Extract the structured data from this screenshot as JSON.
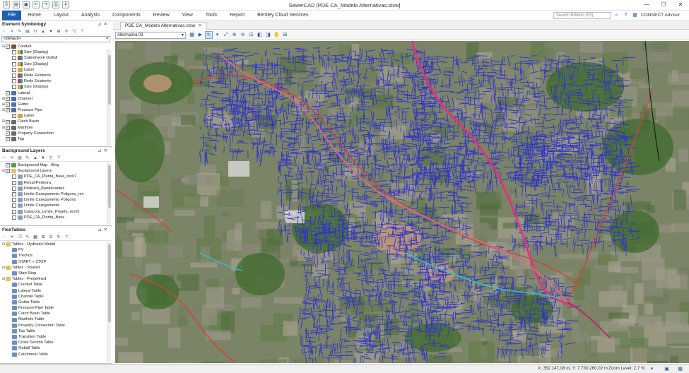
{
  "window": {
    "title": "SewerCAD [PDE CA_Modelo Alternativas.stsw]",
    "controls": [
      "—",
      "☐",
      "✕"
    ]
  },
  "menu": {
    "tabs": [
      "File",
      "Home",
      "Layout",
      "Analysis",
      "Components",
      "Review",
      "View",
      "Tools",
      "Report",
      "Bentley Cloud Services"
    ],
    "search_placeholder": "Search Ribbon (F3)",
    "connect_label": "CONNECT Advisor"
  },
  "element_symbology": {
    "title": "Element Symbology",
    "combo_value": "<default>",
    "items": [
      {
        "label": "Conduit",
        "level": 0,
        "exp": "⊟",
        "checked": true,
        "icon": "conduit"
      },
      {
        "label": "Size (Display)",
        "level": 1,
        "exp": "",
        "checked": false,
        "icon": "size"
      },
      {
        "label": "Subnetwork Outfall",
        "level": 1,
        "exp": "",
        "checked": false,
        "icon": "color"
      },
      {
        "label": "Size (Display)",
        "level": 1,
        "exp": "",
        "checked": false,
        "icon": "size"
      },
      {
        "label": "Label",
        "level": 1,
        "exp": "",
        "checked": false,
        "icon": "label"
      },
      {
        "label": "Rede Existente",
        "level": 1,
        "exp": "",
        "checked": false,
        "icon": "color"
      },
      {
        "label": "Rede Existente-",
        "level": 1,
        "exp": "",
        "checked": false,
        "icon": "color"
      },
      {
        "label": "Size (Display)",
        "level": 1,
        "exp": "",
        "checked": false,
        "icon": "size"
      },
      {
        "label": "Lateral",
        "level": 0,
        "exp": "",
        "checked": true,
        "icon": "line"
      },
      {
        "label": "Channel",
        "level": 0,
        "exp": "⊞",
        "checked": true,
        "icon": "line"
      },
      {
        "label": "Gutter",
        "level": 0,
        "exp": "⊞",
        "checked": true,
        "icon": "line"
      },
      {
        "label": "Pressure Pipe",
        "level": 0,
        "exp": "⊟",
        "checked": true,
        "icon": "line"
      },
      {
        "label": "Label",
        "level": 1,
        "exp": "",
        "checked": true,
        "icon": "label"
      },
      {
        "label": "Catch Basin",
        "level": 0,
        "exp": "⊞",
        "checked": true,
        "icon": "node"
      },
      {
        "label": "Manhole",
        "level": 0,
        "exp": "⊞",
        "checked": true,
        "icon": "node"
      },
      {
        "label": "Property Connection",
        "level": 0,
        "exp": "",
        "checked": true,
        "icon": "node"
      },
      {
        "label": "Tap",
        "level": 0,
        "exp": "",
        "checked": true,
        "icon": "node"
      }
    ]
  },
  "background_layers": {
    "title": "Background Layers",
    "items": [
      {
        "label": "Background Map - Bing",
        "level": 0,
        "exp": "",
        "checked": true,
        "icon": "map"
      },
      {
        "label": "Background Layers",
        "level": 0,
        "exp": "⊟",
        "checked": true,
        "icon": "folder"
      },
      {
        "label": "PDE_CA_Planta_Base_rev07",
        "level": 1,
        "exp": "",
        "checked": false,
        "icon": "layer"
      },
      {
        "label": "Flexal-Pedreira",
        "level": 1,
        "exp": "",
        "checked": false,
        "icon": "layer"
      },
      {
        "label": "Pedreira_Bandeirantes",
        "level": 1,
        "exp": "",
        "checked": false,
        "icon": "layer"
      },
      {
        "label": "Limite Caregamento Poligono_rev",
        "level": 1,
        "exp": "",
        "checked": false,
        "icon": "layer"
      },
      {
        "label": "Limite Caregamento Poligono",
        "level": 1,
        "exp": "",
        "checked": false,
        "icon": "layer"
      },
      {
        "label": "Limite Caregamento",
        "level": 1,
        "exp": "",
        "checked": false,
        "icon": "layer"
      },
      {
        "label": "Catacora_Limite_Projeto_rev01",
        "level": 1,
        "exp": "",
        "checked": false,
        "icon": "layer"
      },
      {
        "label": "PDE_CA_Planta_Base",
        "level": 1,
        "exp": "",
        "checked": false,
        "icon": "layer"
      }
    ]
  },
  "flextables": {
    "title": "FlexTables",
    "items": [
      {
        "label": "Tables - Hydraulic Model",
        "level": 0,
        "exp": "⊟",
        "icon": "folder"
      },
      {
        "label": "PV",
        "level": 1,
        "exp": "",
        "icon": "table"
      },
      {
        "label": "Trechos",
        "level": 1,
        "exp": "",
        "icon": "table"
      },
      {
        "label": "START > STOP",
        "level": 1,
        "exp": "",
        "icon": "table"
      },
      {
        "label": "Tables - Shared",
        "level": 0,
        "exp": "⊟",
        "icon": "folder"
      },
      {
        "label": "Start-Stop",
        "level": 1,
        "exp": "",
        "icon": "table"
      },
      {
        "label": "Tables - Predefined",
        "level": 0,
        "exp": "⊟",
        "icon": "folder"
      },
      {
        "label": "Conduit Table",
        "level": 1,
        "exp": "",
        "icon": "table"
      },
      {
        "label": "Lateral Table",
        "level": 1,
        "exp": "",
        "icon": "table"
      },
      {
        "label": "Channel Table",
        "level": 1,
        "exp": "",
        "icon": "table"
      },
      {
        "label": "Gutter Table",
        "level": 1,
        "exp": "",
        "icon": "table"
      },
      {
        "label": "Pressure Pipe Table",
        "level": 1,
        "exp": "",
        "icon": "table"
      },
      {
        "label": "Catch Basin Table",
        "level": 1,
        "exp": "",
        "icon": "table"
      },
      {
        "label": "Manhole Table",
        "level": 1,
        "exp": "",
        "icon": "table"
      },
      {
        "label": "Property Connection Table",
        "level": 1,
        "exp": "",
        "icon": "table"
      },
      {
        "label": "Tap Table",
        "level": 1,
        "exp": "",
        "icon": "table"
      },
      {
        "label": "Transition Table",
        "level": 1,
        "exp": "",
        "icon": "table"
      },
      {
        "label": "Cross Section Table",
        "level": 1,
        "exp": "",
        "icon": "table"
      },
      {
        "label": "Outfall Table",
        "level": 1,
        "exp": "",
        "icon": "table"
      },
      {
        "label": "Catchment Table",
        "level": 1,
        "exp": "",
        "icon": "table"
      }
    ]
  },
  "document": {
    "tab_label": "PDE CA_Modelo Alternativas.stsw",
    "scenario": "Alternativa 03"
  },
  "status": {
    "coordinates": "X: 352.147,08 m, Y: 7.730.260,02 m",
    "zoom": "Zoom Level: 2,7 %"
  },
  "colors": {
    "file_tab": "#1e5fb3",
    "network_lines": "#2d2fc8",
    "trunk_sewer": "#e5307c",
    "existing_network": "#d0443a",
    "cyan_channel": "#2ec7cf"
  }
}
